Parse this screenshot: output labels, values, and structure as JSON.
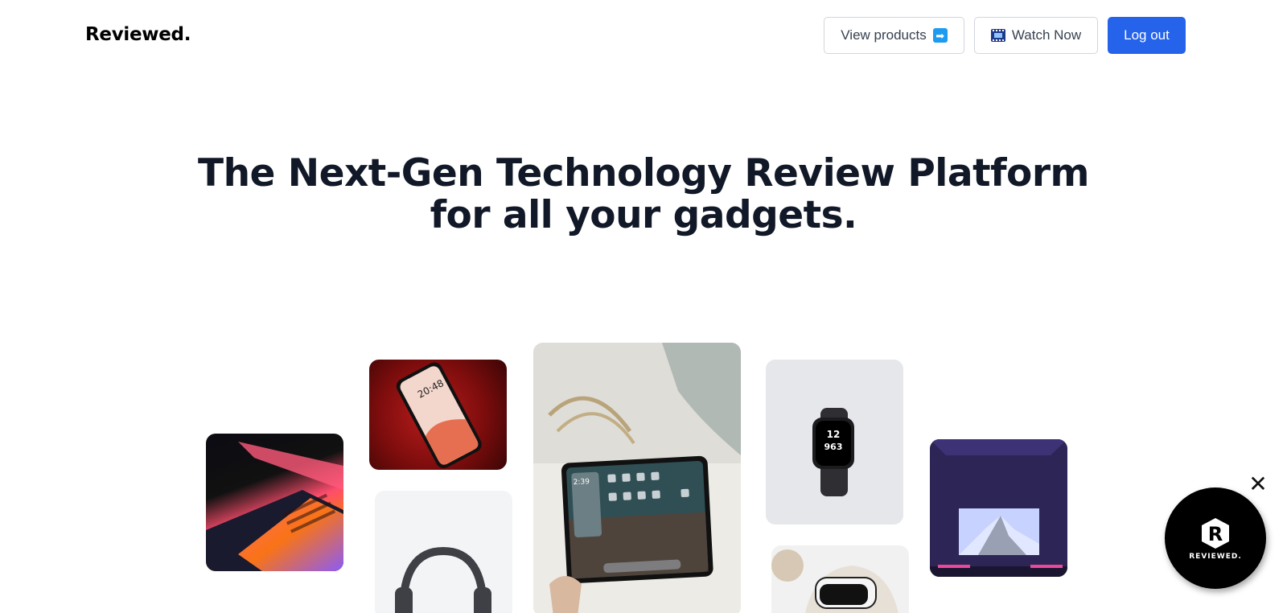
{
  "header": {
    "logo": "Reviewed.",
    "view_products_label": "View products",
    "view_products_icon": "right-arrow-icon",
    "watch_now_label": "Watch Now",
    "watch_now_icon": "film-frames-icon",
    "logout_label": "Log out"
  },
  "hero": {
    "headline_line1": "The Next-Gen Technology Review Platform",
    "headline_line2": "for all your gadgets."
  },
  "gallery": [
    {
      "name": "laptop"
    },
    {
      "name": "smartphone"
    },
    {
      "name": "headphones"
    },
    {
      "name": "tablet"
    },
    {
      "name": "smartwatch"
    },
    {
      "name": "vr-headset"
    },
    {
      "name": "television"
    }
  ],
  "badge": {
    "text": "REVIEWED.",
    "close_icon": "close-icon"
  },
  "colors": {
    "accent": "#2563eb",
    "text": "#111827"
  }
}
